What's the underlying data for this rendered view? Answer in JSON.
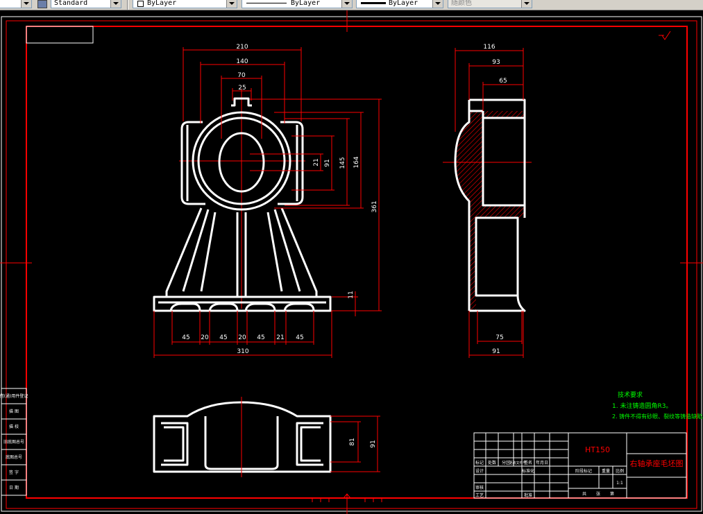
{
  "toolbar": {
    "textstyle": "Standard",
    "layer": "ByLayer",
    "linetype": "ByLayer",
    "lineweight": "ByLayer",
    "plotcolor": "随颜色"
  },
  "drawing": {
    "front_dims": {
      "w210": "210",
      "w140": "140",
      "w70": "70",
      "w25": "25",
      "h21": "21",
      "h91": "91",
      "h145": "145",
      "h164": "164",
      "h361": "361",
      "h11": "11",
      "b45a": "45",
      "b20a": "20",
      "b45b": "45",
      "b20b": "20",
      "b45c": "45",
      "b21": "21",
      "b45d": "45",
      "w310": "310"
    },
    "side_dims": {
      "w116": "116",
      "w93": "93",
      "w65": "65",
      "w75": "75",
      "w91": "91"
    },
    "top_dims": {
      "h81": "81",
      "h91": "91"
    },
    "tech_req": {
      "title": "技术要求",
      "line1": "1. 未注铸造圆角R3。",
      "line2": "2. 铸件不得有砂眼、裂纹等铸造缺陷。"
    },
    "title_block": {
      "material": "HT150",
      "name": "右轴承座毛坯图",
      "h_biaoji": "标记",
      "h_chushu": "处数",
      "h_fenqu": "分区",
      "h_gengai": "更改文件号",
      "h_qianming": "签名",
      "h_nianyue": "年月日",
      "h_sheji": "设计",
      "h_biaozhunhua": "标准化",
      "h_shenhe": "审核",
      "h_gongyi": "工艺",
      "h_pizhun": "批准",
      "h_jieduan": "阶段标记",
      "h_zhongliang": "重量",
      "h_bili": "比例",
      "scale": "1:1",
      "h_gong": "共",
      "h_zhang": "张",
      "h_di": "第"
    },
    "side_labels": {
      "l1": "借(通)用件登记",
      "l2": "描 图",
      "l3": "描 校",
      "l4": "旧底图总号",
      "l5": "底图总号",
      "l6": "签 字",
      "l7": "日 期"
    }
  }
}
